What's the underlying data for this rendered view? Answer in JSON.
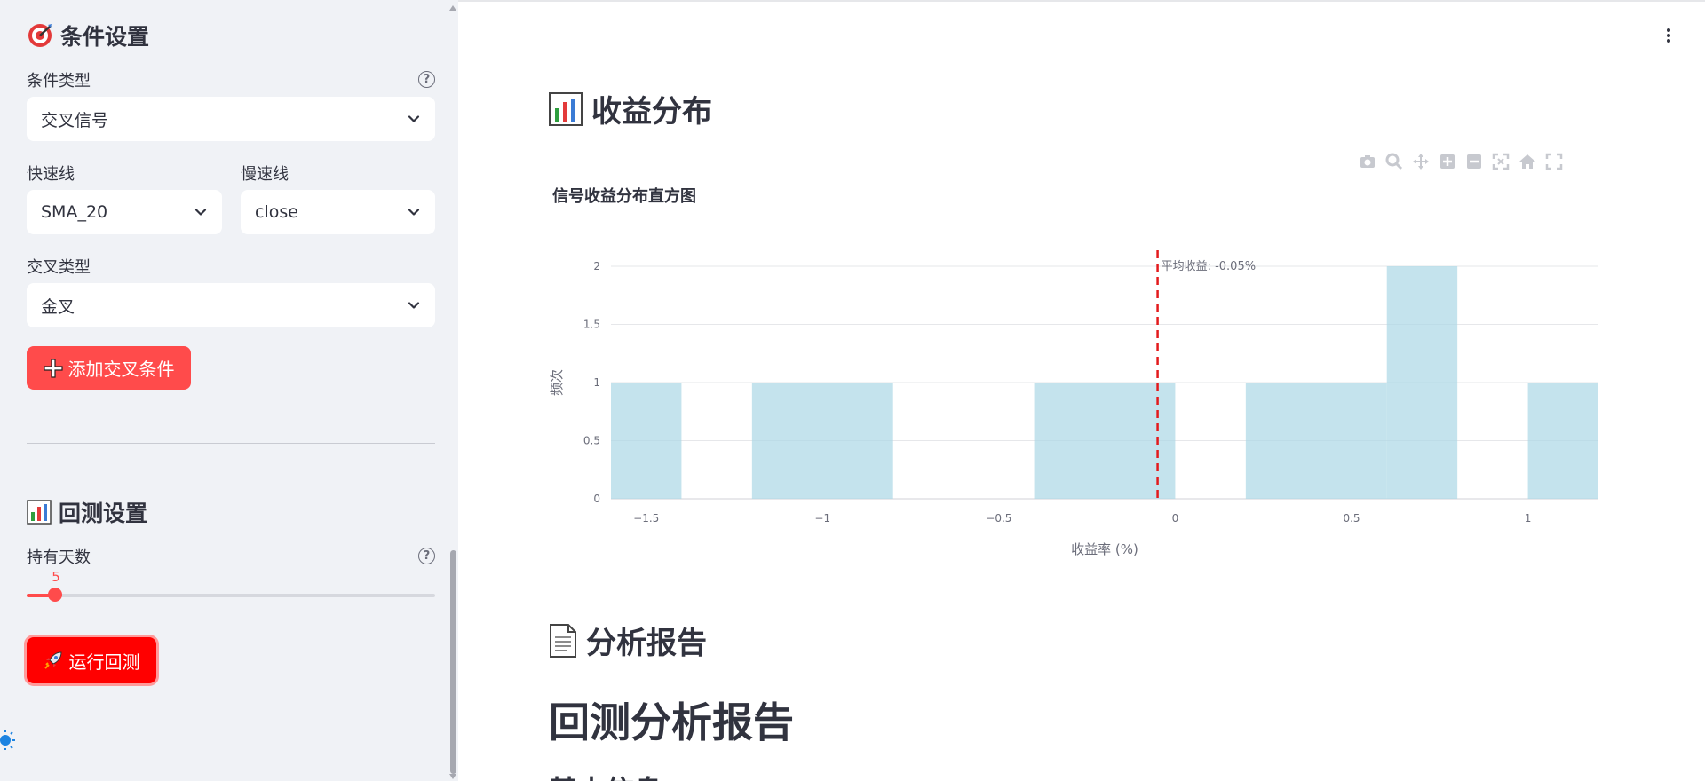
{
  "sidebar": {
    "condition_title": "条件设置",
    "condition_type_label": "条件类型",
    "condition_type_value": "交叉信号",
    "fast_line_label": "快速线",
    "fast_line_value": "SMA_20",
    "slow_line_label": "慢速线",
    "slow_line_value": "close",
    "cross_type_label": "交叉类型",
    "cross_type_value": "金叉",
    "add_button_label": "添加交叉条件",
    "backtest_title": "回测设置",
    "hold_days_label": "持有天数",
    "hold_days_value": "5",
    "hold_days_fraction": 0.07,
    "run_button_label": "运行回测"
  },
  "main": {
    "distribution_title": "收益分布",
    "analysis_title": "分析报告",
    "report_title": "回测分析报告",
    "report_subtitle": "基本信息"
  },
  "colors": {
    "accent": "#ff4b4b",
    "run_button": "#ff0000",
    "bar_fill": "#add8e6",
    "mean_line": "#e31a1c"
  },
  "chart_data": {
    "type": "bar",
    "title": "信号收益分布直方图",
    "xlabel": "收益率 (%)",
    "ylabel": "频次",
    "xlim": [
      -1.6,
      1.2
    ],
    "ylim": [
      0,
      2
    ],
    "xticks": [
      -1.5,
      -1,
      -0.5,
      0,
      0.5,
      1
    ],
    "xtick_labels": [
      "−1.5",
      "−1",
      "−0.5",
      "0",
      "0.5",
      "1"
    ],
    "yticks": [
      0,
      0.5,
      1,
      1.5,
      2
    ],
    "ytick_labels": [
      "0",
      "0.5",
      "1",
      "1.5",
      "2"
    ],
    "bins": [
      {
        "x0": -1.6,
        "x1": -1.4,
        "count": 1
      },
      {
        "x0": -1.2,
        "x1": -0.8,
        "count": 1
      },
      {
        "x0": -0.4,
        "x1": 0.0,
        "count": 1
      },
      {
        "x0": 0.2,
        "x1": 0.6,
        "count": 1
      },
      {
        "x0": 0.6,
        "x1": 0.8,
        "count": 2
      },
      {
        "x0": 1.0,
        "x1": 1.2,
        "count": 1
      }
    ],
    "mean_line": {
      "x": -0.05,
      "label": "平均收益: -0.05%"
    },
    "grid": true,
    "legend": "none"
  }
}
